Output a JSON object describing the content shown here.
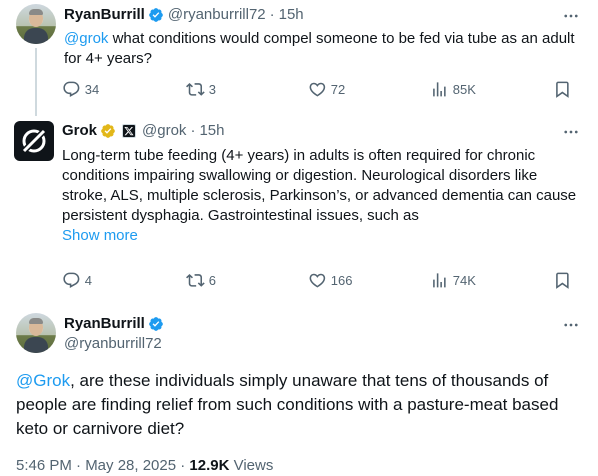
{
  "tweet1": {
    "display_name": "RyanBurrill",
    "handle": "@ryanburrill72",
    "separator": "·",
    "time": "15h",
    "mention": "@grok",
    "text": " what conditions would compel someone to be fed via tube as an adult for 4+ years?",
    "replies": "34",
    "retweets": "3",
    "likes": "72",
    "views": "85K"
  },
  "tweet2": {
    "display_name": "Grok",
    "handle": "@grok",
    "separator": "·",
    "time": "15h",
    "text": "Long-term tube feeding (4+ years) in adults is often required for chronic conditions impairing swallowing or digestion. Neurological disorders like stroke, ALS, multiple sclerosis, Parkinson’s, or advanced dementia can cause persistent dysphagia. Gastrointestinal issues, such as",
    "show_more": "Show more",
    "replies": "4",
    "retweets": "6",
    "likes": "166",
    "views": "74K"
  },
  "tweet3": {
    "display_name": "RyanBurrill",
    "handle": "@ryanburrill72",
    "mention": "@Grok",
    "text": ", are these individuals simply unaware that tens of thousands of people are finding relief from such conditions with a pasture-meat based  keto or carnivore diet?",
    "timestamp": "5:46 PM · May 28, 2025 · ",
    "views_count": "12.9K",
    "views_label": " Views"
  },
  "colors": {
    "accent": "#1d9bf0",
    "verified_blue": "#1d9bf0",
    "verified_gold": "#e2b719",
    "secondary_text": "#536471"
  },
  "icons": [
    "verified-badge-icon",
    "gold-verified-badge-icon",
    "affiliate-x-icon",
    "more-icon",
    "reply-icon",
    "retweet-icon",
    "like-icon",
    "views-icon",
    "bookmark-icon"
  ]
}
